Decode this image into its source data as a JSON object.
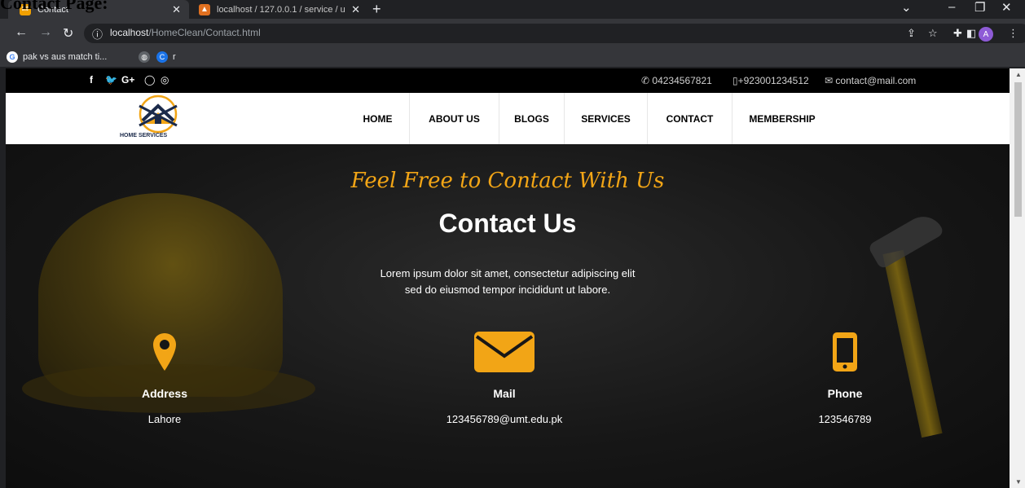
{
  "overlay": {
    "heading": "Contact Page:"
  },
  "browser": {
    "tabs": [
      {
        "label": "Contact",
        "active": true
      },
      {
        "label": "localhost / 127.0.0.1 / service / u",
        "active": false
      }
    ],
    "url_prefix": "localhost",
    "url_rest": "/HomeClean/Contact.html",
    "bookmarks": [
      {
        "label": "pak vs aus match ti..."
      },
      {
        "label": ""
      },
      {
        "label": "r"
      }
    ],
    "avatar_initial": "A",
    "accent": "#8e5bd6"
  },
  "site": {
    "topbar": {
      "social_icons": [
        "facebook-icon",
        "twitter-icon",
        "google-plus-icon",
        "whatsapp-icon",
        "instagram-icon"
      ],
      "phone1": "04234567821",
      "phone2": "+923001234512",
      "email": "contact@mail.com"
    },
    "logo_text": "HOME SERVICES",
    "nav": [
      "HOME",
      "ABOUT US",
      "BLOGS",
      "SERVICES",
      "CONTACT",
      "MEMBERSHIP"
    ],
    "hero": {
      "script_title": "Feel Free to Contact With Us",
      "title": "Contact Us",
      "desc_line1": "Lorem ipsum dolor sit amet, consectetur adipiscing elit",
      "desc_line2": "sed do eiusmod tempor incididunt ut labore."
    },
    "info": [
      {
        "icon": "location-pin-icon",
        "label": "Address",
        "value": "Lahore"
      },
      {
        "icon": "mail-icon",
        "label": "Mail",
        "value": "123456789@umt.edu.pk"
      },
      {
        "icon": "phone-icon",
        "label": "Phone",
        "value": "123546789"
      }
    ],
    "colors": {
      "accent": "#f2a516",
      "topbar": "#000000",
      "hero": "#171717"
    }
  }
}
